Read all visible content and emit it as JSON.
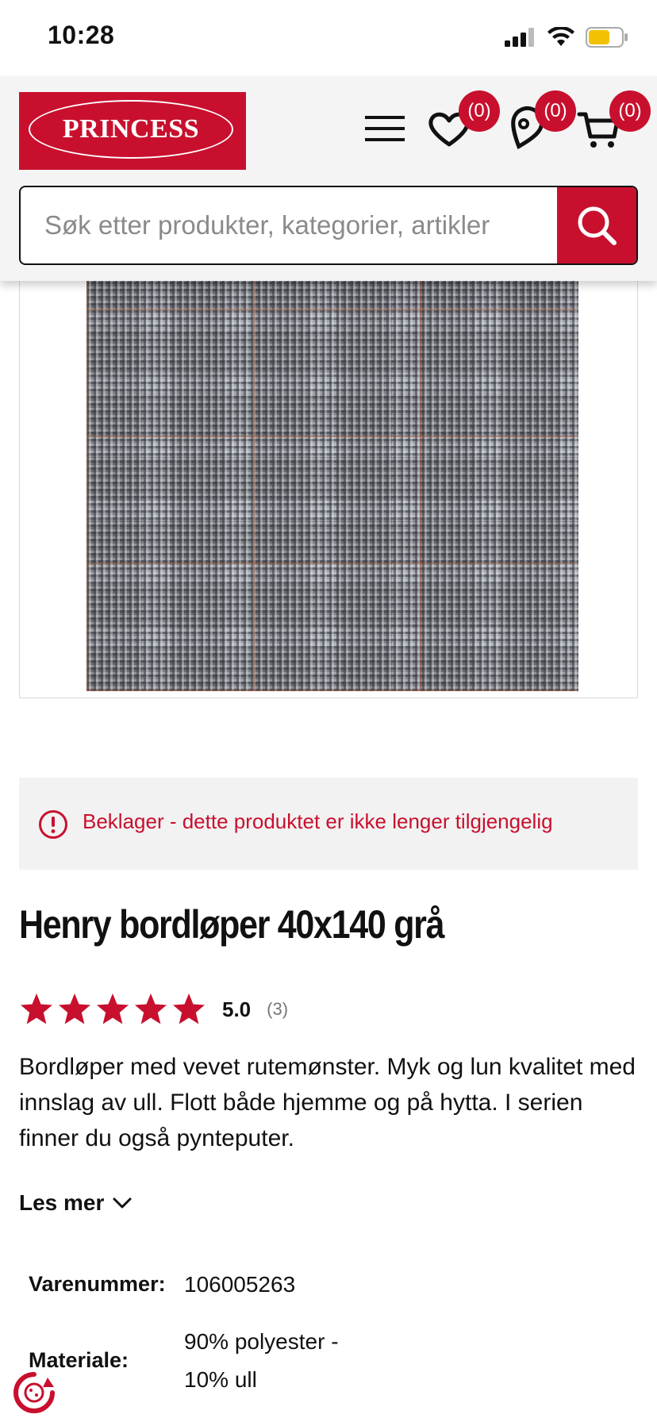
{
  "status_bar": {
    "time": "10:28"
  },
  "header": {
    "logo_text": "PRINCESS",
    "wishlist_count": "(0)",
    "stores_count": "(0)",
    "cart_count": "(0)",
    "search_placeholder": "Søk etter produkter, kategorier, artikler"
  },
  "notice": {
    "text": "Beklager - dette produktet er ikke lenger tilgjengelig"
  },
  "product": {
    "title": "Henry bordløper 40x140 grå",
    "rating": "5.0",
    "review_count": "(3)",
    "rating_stars": 5,
    "description": "Bordløper med vevet rutemønster. Myk og lun kvalitet med innslag av ull. Flott både hjemme og på hytta. I serien finner du også pynteputer.",
    "read_more": "Les mer",
    "specs": [
      {
        "label": "Varenummer:",
        "value": "106005263"
      },
      {
        "label": "Materiale:",
        "value_line1": "90% polyester -",
        "value_line2": "10% ull"
      }
    ]
  },
  "colors": {
    "brand_red": "#c8102e",
    "alert_bg": "#f2f2f2"
  }
}
